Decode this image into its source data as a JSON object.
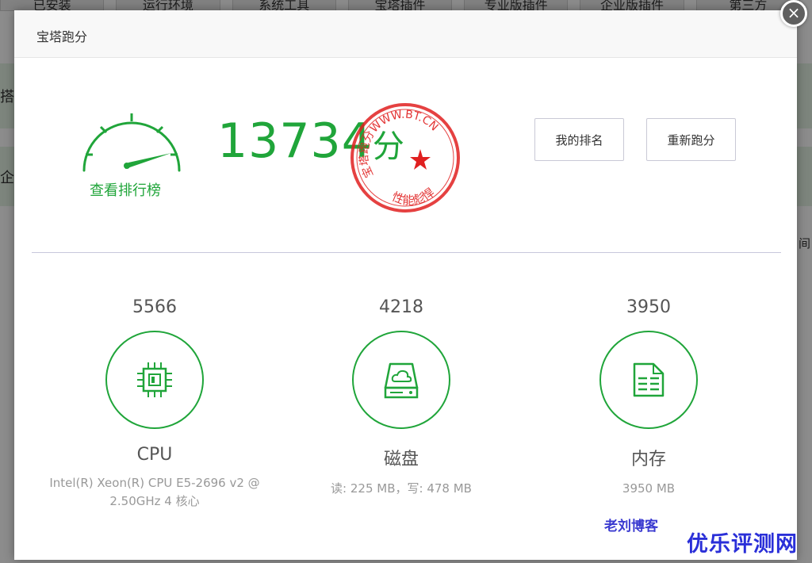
{
  "background": {
    "tabs": [
      "已安装",
      "运行环境",
      "系统工具",
      "宝塔插件",
      "专业版插件",
      "企业版插件",
      "第三方"
    ],
    "side_text_1": "搭建",
    "side_text_2": "企业",
    "right_text": "间"
  },
  "modal": {
    "title": "宝塔跑分",
    "close_label": "×"
  },
  "summary": {
    "rank_link": "查看排行榜",
    "total_score": "13734",
    "score_unit": "分",
    "stamp_top_text": "宝塔跑分WWW.BT.CN",
    "stamp_bottom_text": "性能彪悍"
  },
  "buttons": {
    "my_rank": "我的排名",
    "rerun": "重新跑分"
  },
  "metrics": [
    {
      "score": "5566",
      "name": "CPU",
      "detail": "Intel(R) Xeon(R) CPU E5-2696 v2 @ 2.50GHz 4 核心",
      "icon": "cpu-icon"
    },
    {
      "score": "4218",
      "name": "磁盘",
      "detail": "读: 225 MB，写: 478 MB",
      "icon": "disk-icon"
    },
    {
      "score": "3950",
      "name": "内存",
      "detail": "3950 MB",
      "icon": "memory-icon"
    }
  ],
  "watermarks": {
    "blog": "老刘博客",
    "site": "优乐评测网"
  },
  "colors": {
    "accent": "#20a53a",
    "stamp": "#e02020"
  }
}
